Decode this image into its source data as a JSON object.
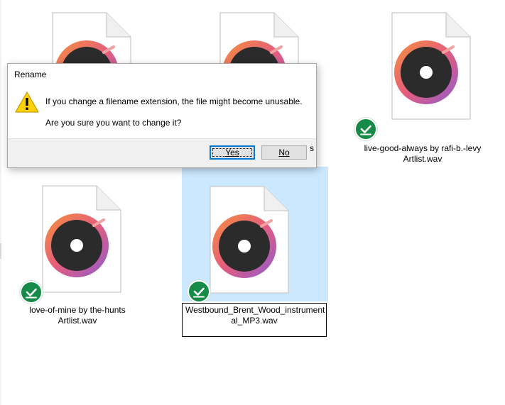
{
  "dialog": {
    "title": "Rename",
    "message": "If you change a filename extension, the file might become unusable.",
    "question": "Are you sure you want to change it?",
    "yes_label": "Yes",
    "no_label": "No",
    "warning_icon": "warning-icon"
  },
  "files": [
    {
      "name_line1": "",
      "name_line2": "",
      "status": "synced",
      "state": "partially-hidden"
    },
    {
      "name_line1": "",
      "name_line2": "",
      "status": "synced",
      "state": "partially-hidden"
    },
    {
      "name_line1": "live-good-always by rafi-b.-levy",
      "name_line2": "Artlist.wav",
      "status": "synced"
    },
    {
      "name_line1": "love-of-mine by the-hunts",
      "name_line2": "Artlist.wav",
      "status": "synced"
    },
    {
      "name_line1": "Westbound_Brent_Wood_instrument",
      "name_line2": "al_MP3.wav",
      "status": "synced",
      "state": "selected-renaming"
    }
  ],
  "occluded_text": "s",
  "colors": {
    "selection": "#cce8ff",
    "sync_badge": "#168a47",
    "dialog_footer": "#f0f0f0",
    "default_button_border": "#0078d7",
    "icon_ring_gradient": [
      "#f08a3c",
      "#e05a7a",
      "#9b5fc9"
    ]
  }
}
